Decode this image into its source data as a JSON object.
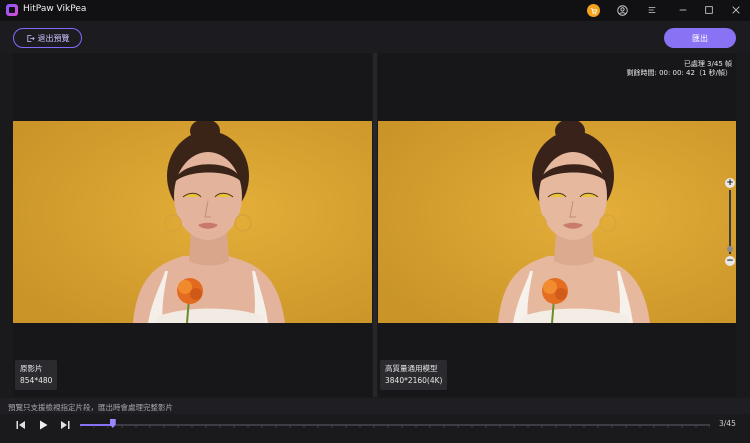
{
  "app": {
    "title": "HitPaw VikPea"
  },
  "toolbar": {
    "exit_preview_label": "退出預覽",
    "export_label": "匯出"
  },
  "left_panel": {
    "name": "原影片",
    "resolution": "854*480"
  },
  "right_panel": {
    "name": "高質量通用模型",
    "resolution": "3840*2160(4K)",
    "status_processed": "已處理 3/45 幀",
    "status_remaining": "剩餘時間: 00: 00: 42（1 秒/幀）"
  },
  "zoom": {
    "plus": "+",
    "minus": "−"
  },
  "hint": {
    "text": "預覽只支援檢視指定片段，匯出時會處理完整影片"
  },
  "player": {
    "current_frame": 3,
    "total_frames": 45,
    "counter_text": "3/45"
  },
  "icons": [
    "app-logo-icon",
    "cart-icon",
    "user-icon",
    "menu-icon",
    "minimize-icon",
    "maximize-icon",
    "close-icon",
    "exit-icon",
    "prev-frame-icon",
    "play-icon",
    "next-frame-icon"
  ],
  "colors": {
    "accent": "#8a72f5",
    "background_photo": "#dca42f",
    "cart": "#f2a31b"
  }
}
